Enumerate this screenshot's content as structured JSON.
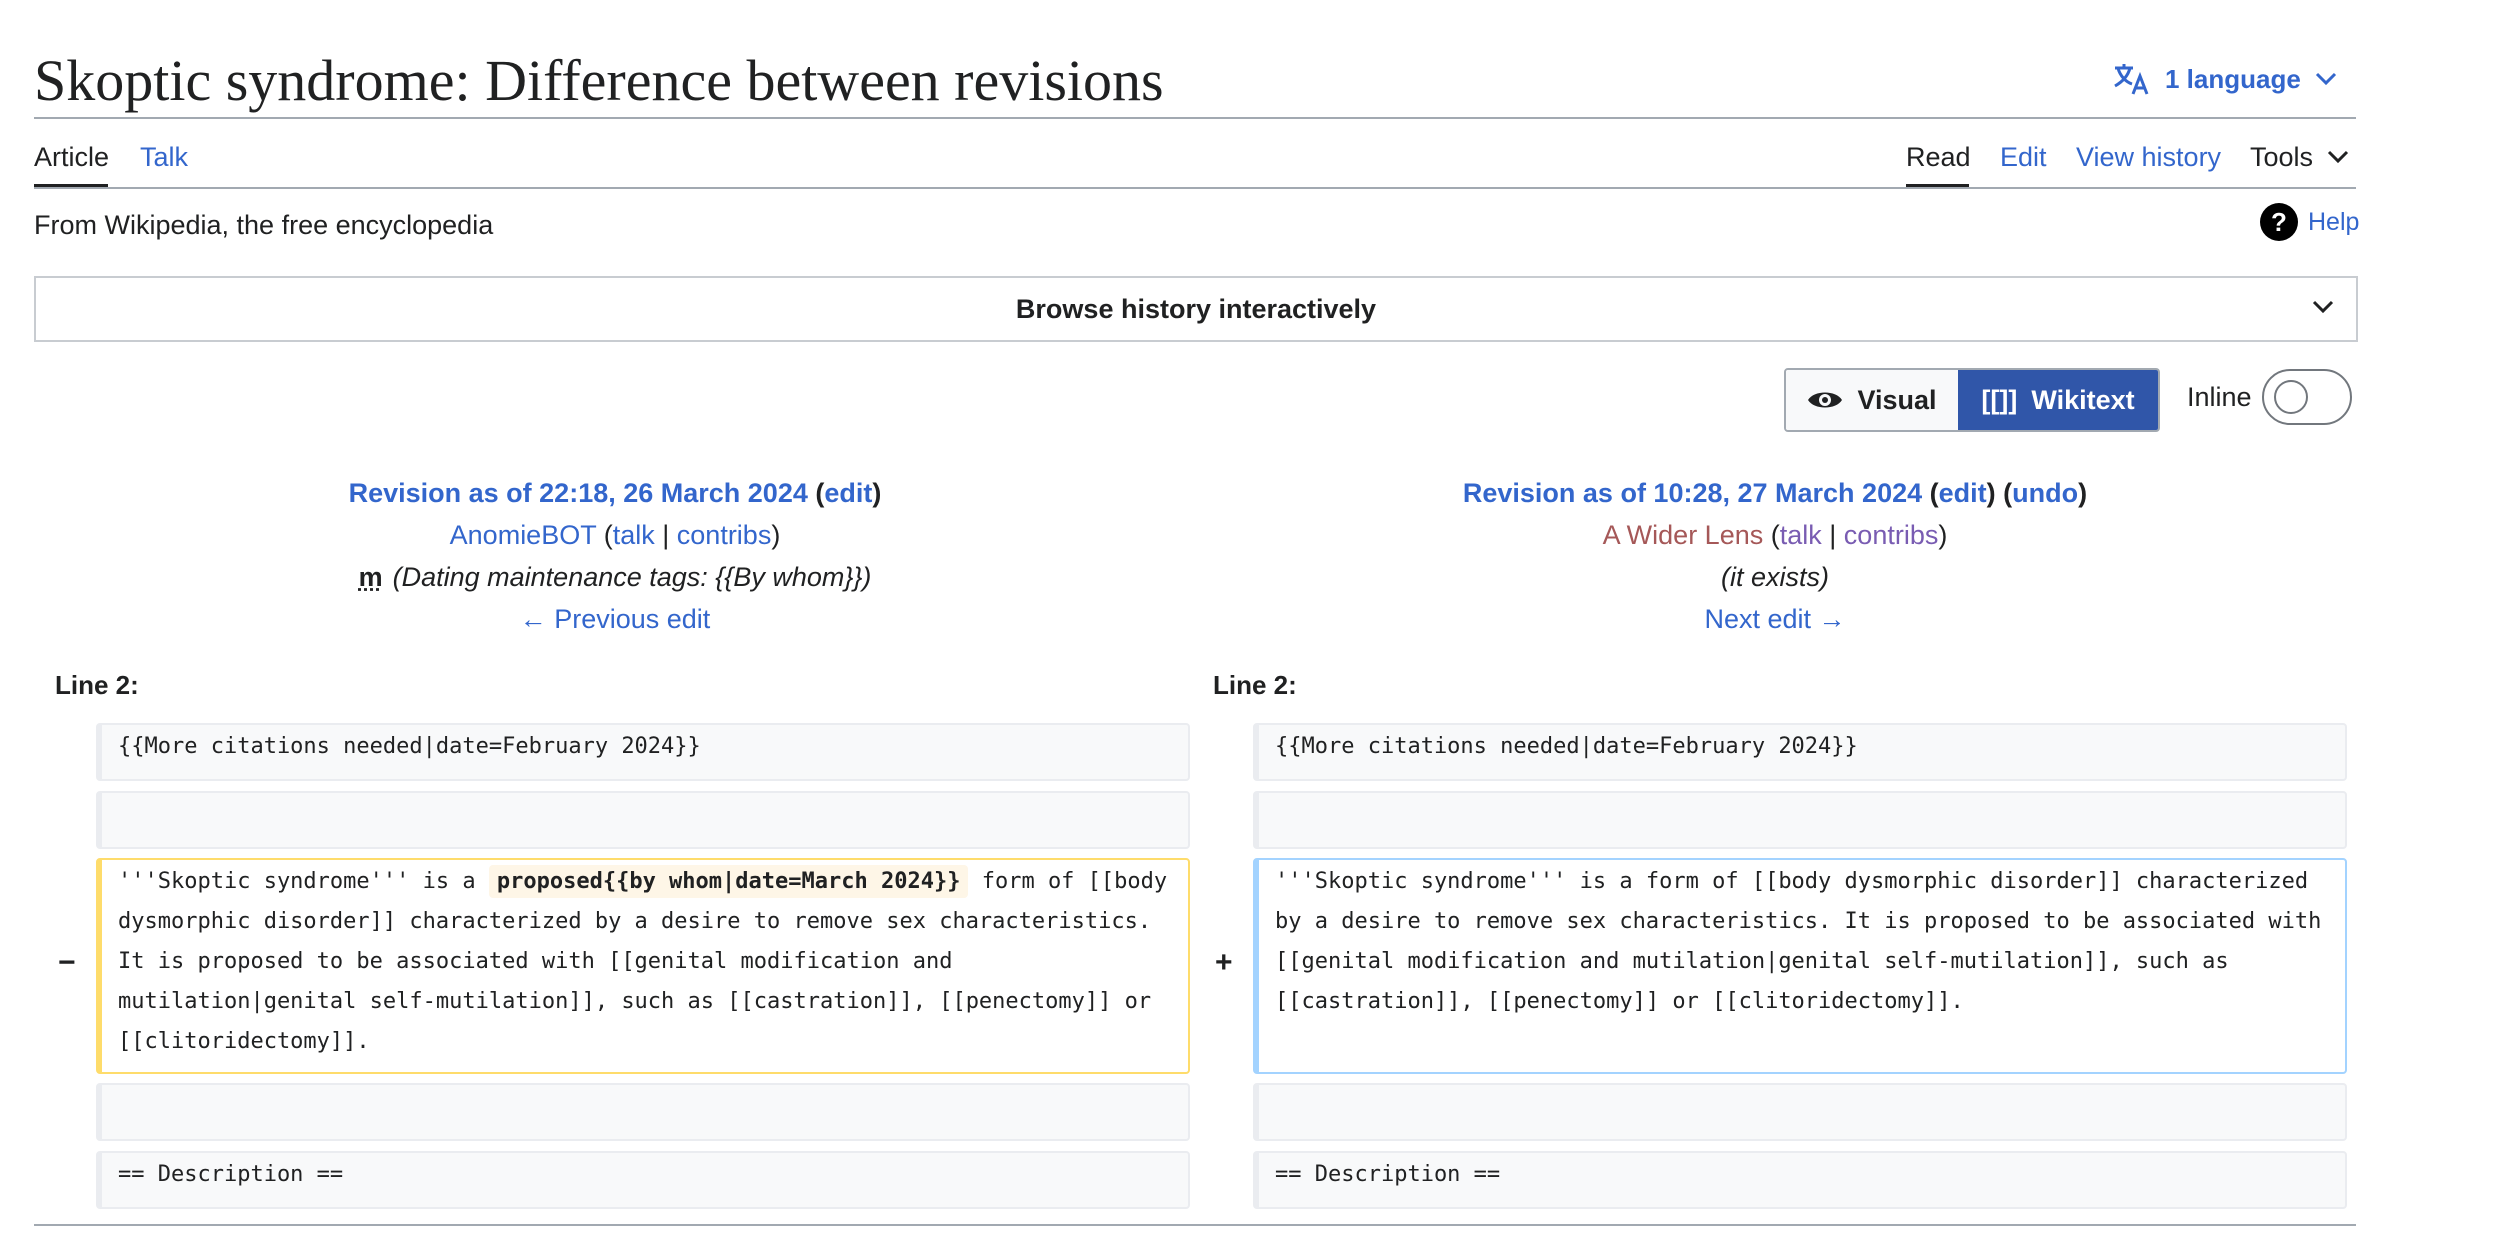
{
  "page": {
    "title": "Skoptic syndrome: Difference between revisions",
    "language_label": "1 language",
    "tagline": "From Wikipedia, the free encyclopedia",
    "help_label": "Help"
  },
  "tabs": {
    "article": "Article",
    "talk": "Talk",
    "read": "Read",
    "edit": "Edit",
    "view_history": "View history",
    "tools": "Tools"
  },
  "browse": {
    "label": "Browse history interactively"
  },
  "view_toggle": {
    "visual": "Visual",
    "wikitext_icon": "[[]]",
    "wikitext": "Wikitext",
    "inline": "Inline",
    "inline_on": false
  },
  "left_revision": {
    "title": "Revision as of 22:18, 26 March 2024",
    "edit": "edit",
    "user": "AnomieBOT",
    "talk": "talk",
    "contribs": "contribs",
    "minor_flag": "m",
    "summary": "(Dating maintenance tags: {{By whom}})",
    "nav": "← Previous edit"
  },
  "right_revision": {
    "title": "Revision as of 10:28, 27 March 2024",
    "edit": "edit",
    "undo": "undo",
    "user": "A Wider Lens",
    "talk": "talk",
    "contribs": "contribs",
    "summary": "(it exists)",
    "nav": "Next edit →"
  },
  "diff": {
    "line_left": "Line 2:",
    "line_right": "Line 2:",
    "context_1": "{{More citations needed|date=February 2024}}",
    "context_2": "",
    "del_marker": "−",
    "add_marker": "+",
    "del_before": "'''Skoptic syndrome''' is a ",
    "del_highlight": "proposed{{by whom|date=March 2024}}",
    "del_after": " form of [[body dysmorphic disorder]] characterized by a desire to remove sex characteristics. It is proposed to be associated with [[genital modification and mutilation|genital self-mutilation]], such as [[castration]], [[penectomy]] or [[clitoridectomy]].",
    "add_text": "'''Skoptic syndrome''' is a form of [[body dysmorphic disorder]] characterized by a desire to remove sex characteristics. It is proposed to be associated with [[genital modification and mutilation|genital self-mutilation]], such as [[castration]], [[penectomy]] or [[clitoridectomy]].",
    "context_3": "",
    "context_4": "== Description =="
  },
  "colors": {
    "link": "#3366cc",
    "primary_button": "#3056a9",
    "deleted_border": "#fedc6b",
    "added_border": "#a3d3ff",
    "user_redlink": "#a55858",
    "visited_link": "#795cb2"
  }
}
